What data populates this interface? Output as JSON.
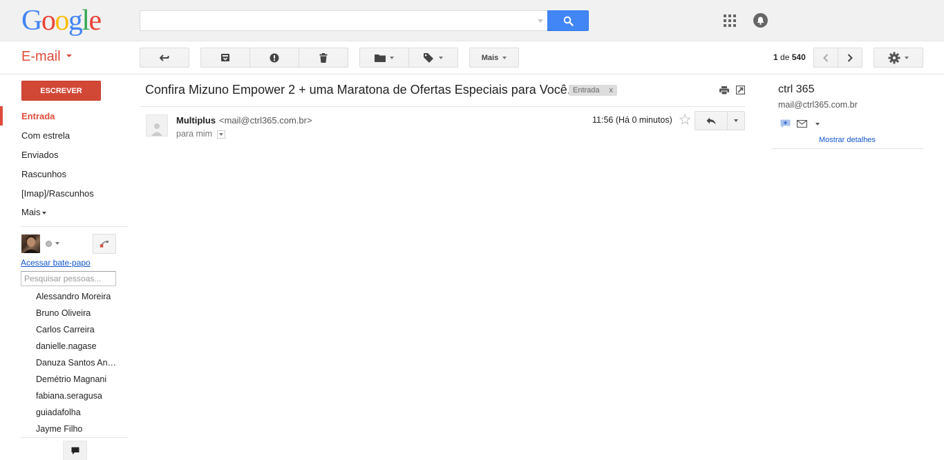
{
  "header": {
    "logo_letters": [
      "G",
      "o",
      "o",
      "g",
      "l",
      "e"
    ],
    "search": {
      "placeholder": "",
      "value": ""
    }
  },
  "colors": {
    "brand_blue": "#4285f4",
    "brand_red": "#dd4b39",
    "compose_red": "#d14836",
    "link": "#1155cc"
  },
  "toolbar": {
    "app_title": "E-mail",
    "back_icon": "back-arrow-icon",
    "archive_icon": "archive-icon",
    "spam_icon": "report-spam-icon",
    "delete_icon": "trash-icon",
    "move_icon": "folder-icon",
    "labels_icon": "tag-icon",
    "more_label": "Mais",
    "pager": {
      "current": "1",
      "sep": "de",
      "total": "540"
    }
  },
  "sidebar": {
    "compose_label": "ESCREVER",
    "items": [
      {
        "label": "Entrada",
        "active": true
      },
      {
        "label": "Com estrela"
      },
      {
        "label": "Enviados"
      },
      {
        "label": "Rascunhos"
      },
      {
        "label": "[Imap]/Rascunhos"
      },
      {
        "label": "Mais"
      }
    ],
    "chat": {
      "link_label": "Acessar bate-papo",
      "search_placeholder": "Pesquisar pessoas...",
      "contacts": [
        "Alessandro Moreira",
        "Bruno Oliveira",
        "Carlos Carreira",
        "danielle.nagase",
        "Danuza Santos Andrade",
        "Demétrio Magnani",
        "fabiana.seragusa",
        "guiadafolha",
        "Jayme Filho"
      ]
    }
  },
  "message": {
    "subject": "Confira Mizuno Empower 2 + uma Maratona de Ofertas Especiais para Você.",
    "label": "Entrada",
    "label_close": "x",
    "sender_name": "Multiplus",
    "sender_email": "<mail@ctrl365.com.br>",
    "to": "para mim",
    "time": "11:56 (Há 0 minutos)"
  },
  "right_panel": {
    "name": "ctrl 365",
    "email": "mail@ctrl365.com.br",
    "details_link": "Mostrar detalhes"
  }
}
